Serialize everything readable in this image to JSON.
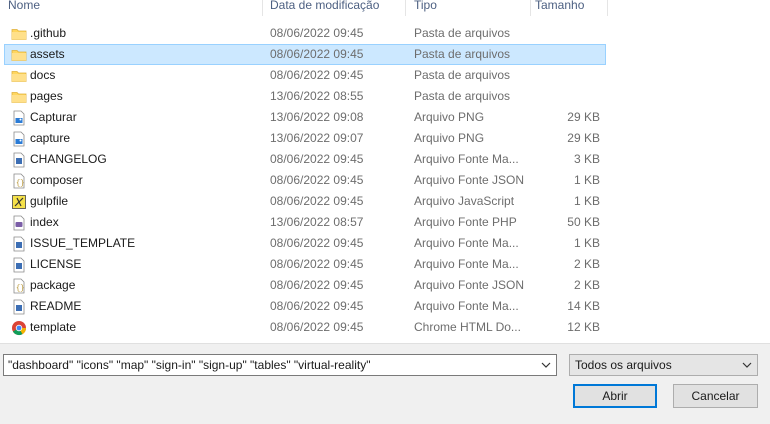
{
  "columns": {
    "name": "Nome",
    "date": "Data de modificação",
    "type": "Tipo",
    "size": "Tamanho"
  },
  "files": [
    {
      "name": ".github",
      "date": "08/06/2022 09:45",
      "type": "Pasta de arquivos",
      "size": "",
      "icon": "folder-icon"
    },
    {
      "name": "assets",
      "date": "08/06/2022 09:45",
      "type": "Pasta de arquivos",
      "size": "",
      "icon": "folder-icon",
      "selected": true
    },
    {
      "name": "docs",
      "date": "08/06/2022 09:45",
      "type": "Pasta de arquivos",
      "size": "",
      "icon": "folder-icon"
    },
    {
      "name": "pages",
      "date": "13/06/2022 08:55",
      "type": "Pasta de arquivos",
      "size": "",
      "icon": "folder-icon"
    },
    {
      "name": "Capturar",
      "date": "13/06/2022 09:08",
      "type": "Arquivo PNG",
      "size": "29 KB",
      "icon": "png-file-icon"
    },
    {
      "name": "capture",
      "date": "13/06/2022 09:07",
      "type": "Arquivo PNG",
      "size": "29 KB",
      "icon": "png-file-icon"
    },
    {
      "name": "CHANGELOG",
      "date": "08/06/2022 09:45",
      "type": "Arquivo Fonte Ma...",
      "size": "3 KB",
      "icon": "markdown-file-icon"
    },
    {
      "name": "composer",
      "date": "08/06/2022 09:45",
      "type": "Arquivo Fonte JSON",
      "size": "1 KB",
      "icon": "json-file-icon"
    },
    {
      "name": "gulpfile",
      "date": "08/06/2022 09:45",
      "type": "Arquivo JavaScript",
      "size": "1 KB",
      "icon": "javascript-file-icon"
    },
    {
      "name": "index",
      "date": "13/06/2022 08:57",
      "type": "Arquivo Fonte PHP",
      "size": "50 KB",
      "icon": "php-file-icon"
    },
    {
      "name": "ISSUE_TEMPLATE",
      "date": "08/06/2022 09:45",
      "type": "Arquivo Fonte Ma...",
      "size": "1 KB",
      "icon": "markdown-file-icon"
    },
    {
      "name": "LICENSE",
      "date": "08/06/2022 09:45",
      "type": "Arquivo Fonte Ma...",
      "size": "2 KB",
      "icon": "markdown-file-icon"
    },
    {
      "name": "package",
      "date": "08/06/2022 09:45",
      "type": "Arquivo Fonte JSON",
      "size": "2 KB",
      "icon": "json-file-icon"
    },
    {
      "name": "README",
      "date": "08/06/2022 09:45",
      "type": "Arquivo Fonte Ma...",
      "size": "14 KB",
      "icon": "markdown-file-icon"
    },
    {
      "name": "template",
      "date": "08/06/2022 09:45",
      "type": "Chrome HTML Do...",
      "size": "12 KB",
      "icon": "chrome-html-file-icon"
    }
  ],
  "filename_value": "\"dashboard\" \"icons\" \"map\" \"sign-in\" \"sign-up\" \"tables\" \"virtual-reality\"",
  "filter_value": "Todos os arquivos",
  "buttons": {
    "open": "Abrir",
    "cancel": "Cancelar"
  },
  "colors": {
    "selection": "#cce8ff",
    "folder": "#ffd65e",
    "accent": "#0078d7"
  }
}
